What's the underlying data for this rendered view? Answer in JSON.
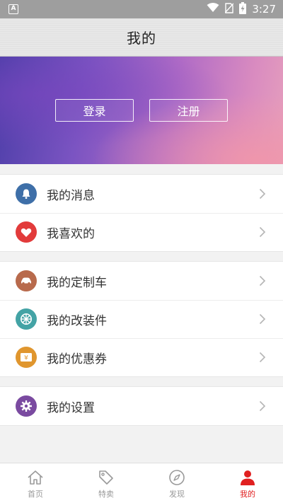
{
  "status_bar": {
    "notification_icon": "A",
    "time": "3:27",
    "icons": [
      "wifi-icon",
      "no-sim-icon",
      "battery-charging-icon"
    ]
  },
  "header": {
    "title": "我的"
  },
  "hero": {
    "login_label": "登录",
    "register_label": "注册"
  },
  "menu": {
    "group1": [
      {
        "label": "我的消息",
        "icon": "bell-icon",
        "color": "#3e6fa8"
      },
      {
        "label": "我喜欢的",
        "icon": "heart-icon",
        "color": "#e23b3b"
      }
    ],
    "group2": [
      {
        "label": "我的定制车",
        "icon": "car-icon",
        "color": "#b86a4c"
      },
      {
        "label": "我的改装件",
        "icon": "wheel-icon",
        "color": "#43a3a5"
      },
      {
        "label": "我的优惠券",
        "icon": "coupon-icon",
        "color": "#e0962e"
      }
    ],
    "group3": [
      {
        "label": "我的设置",
        "icon": "gear-icon",
        "color": "#7a4aa0"
      }
    ]
  },
  "tabs": [
    {
      "label": "首页",
      "icon": "home-icon",
      "active": false
    },
    {
      "label": "特卖",
      "icon": "tag-icon",
      "active": false
    },
    {
      "label": "发现",
      "icon": "compass-icon",
      "active": false
    },
    {
      "label": "我的",
      "icon": "user-icon",
      "active": true
    }
  ],
  "colors": {
    "accent": "#e02020",
    "inactive_tab": "#999999"
  }
}
